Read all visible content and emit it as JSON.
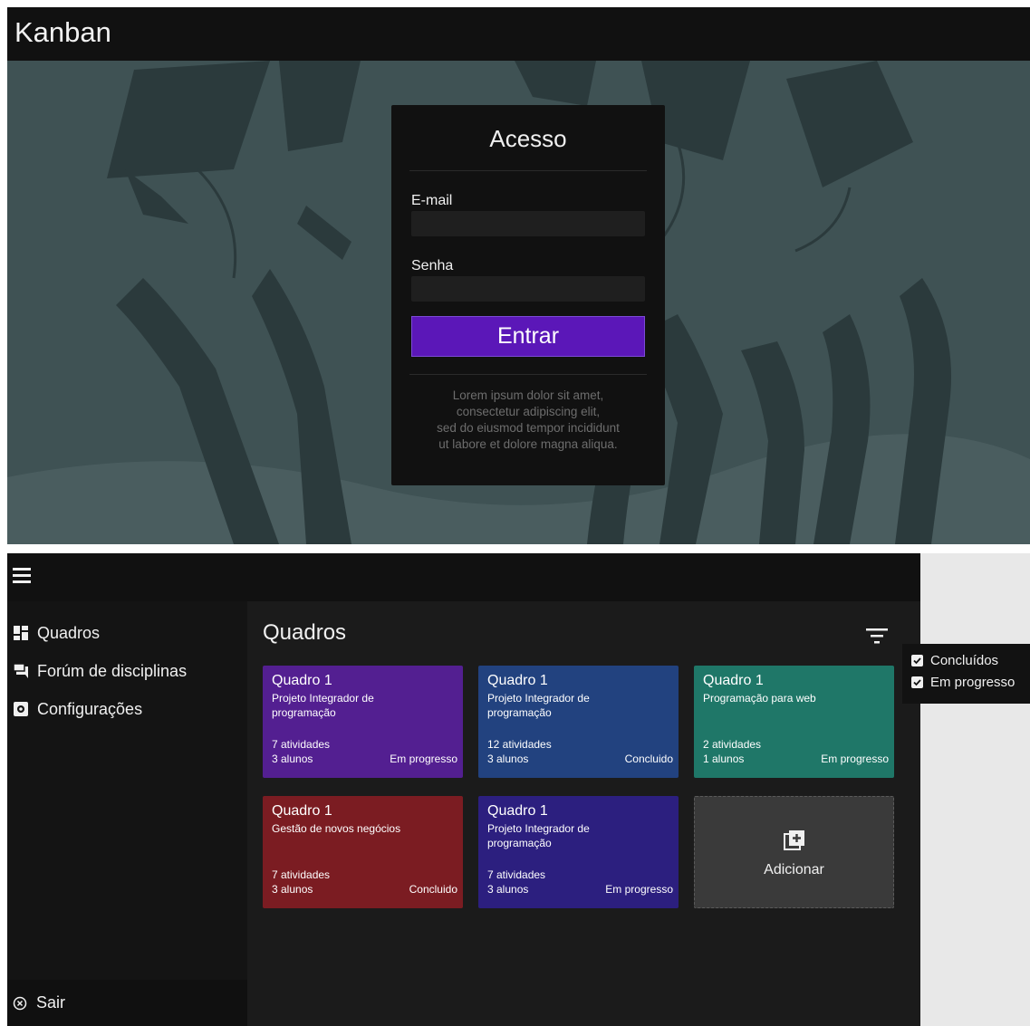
{
  "login": {
    "app_title": "Kanban",
    "card_title": "Acesso",
    "email_label": "E-mail",
    "email_value": "",
    "password_label": "Senha",
    "password_value": "",
    "submit_label": "Entrar",
    "lorem_lines": [
      "Lorem ipsum dolor sit amet,",
      "consectetur adipiscing elit,",
      "sed do eiusmod tempor incididunt",
      "ut labore et dolore magna aliqua."
    ],
    "accent_color": "#5b17b8"
  },
  "boards": {
    "menu_icon": "hamburger-icon",
    "sidebar": {
      "items": [
        {
          "label": "Quadros",
          "icon": "dashboard-icon"
        },
        {
          "label": "Forúm de disciplinas",
          "icon": "forum-icon"
        },
        {
          "label": "Configurações",
          "icon": "settings-icon"
        }
      ],
      "logout_label": "Sair",
      "logout_icon": "close-circle-icon"
    },
    "page_title": "Quadros",
    "filter_icon": "filter-icon",
    "cards": [
      {
        "title": "Quadro 1",
        "subtitle": "Projeto Integrador de programação",
        "activities": "7 atividades",
        "students": "3 alunos",
        "status": "Em progresso",
        "color": "#531f91"
      },
      {
        "title": "Quadro 1",
        "subtitle": "Projeto Integrador de programação",
        "activities": "12 atividades",
        "students": "3 alunos",
        "status": "Concluido",
        "color": "#22427f"
      },
      {
        "title": "Quadro 1",
        "subtitle": "Programação para web",
        "activities": "2 atividades",
        "students": "1 alunos",
        "status": "Em progresso",
        "color": "#1f7768"
      },
      {
        "title": "Quadro 1",
        "subtitle": "Gestão de novos negócios",
        "activities": "7 atividades",
        "students": "3 alunos",
        "status": "Concluido",
        "color": "#7b1c22"
      },
      {
        "title": "Quadro 1",
        "subtitle": "Projeto Integrador de programação",
        "activities": "7 atividades",
        "students": "3 alunos",
        "status": "Em progresso",
        "color": "#2c1f7f"
      }
    ],
    "add_label": "Adicionar",
    "add_icon": "add-box-icon",
    "filter_menu": [
      {
        "label": "Concluídos",
        "checked": true
      },
      {
        "label": "Em progresso",
        "checked": true
      }
    ]
  }
}
